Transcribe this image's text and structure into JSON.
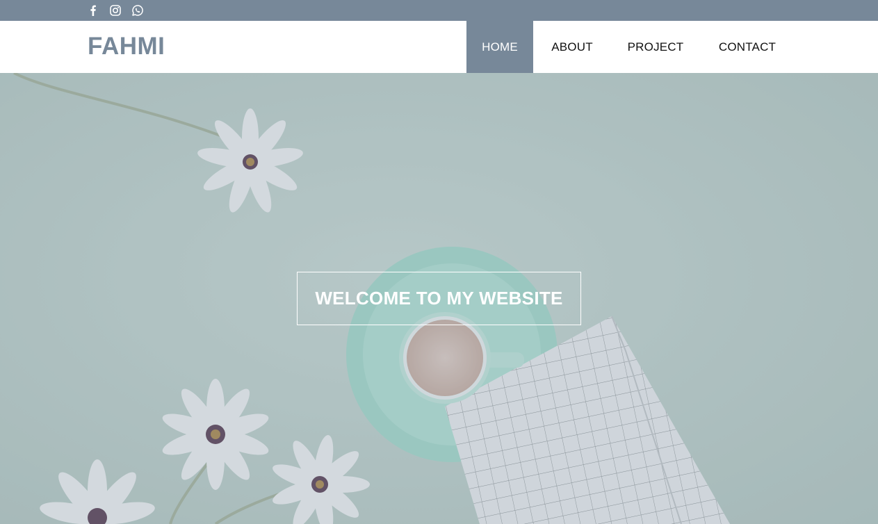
{
  "social": {
    "icons": [
      "facebook-icon",
      "instagram-icon",
      "whatsapp-icon"
    ]
  },
  "brand": {
    "name": "FAHMI"
  },
  "nav": {
    "items": [
      {
        "label": "HOME",
        "active": true
      },
      {
        "label": "ABOUT",
        "active": false
      },
      {
        "label": "PROJECT",
        "active": false
      },
      {
        "label": "CONTACT",
        "active": false
      }
    ]
  },
  "hero": {
    "welcome_text": "WELCOME TO MY WEBSITE"
  },
  "colors": {
    "accent": "#778899",
    "white": "#ffffff",
    "nav_text": "#111111",
    "hero_background": "#b4c6bf"
  }
}
